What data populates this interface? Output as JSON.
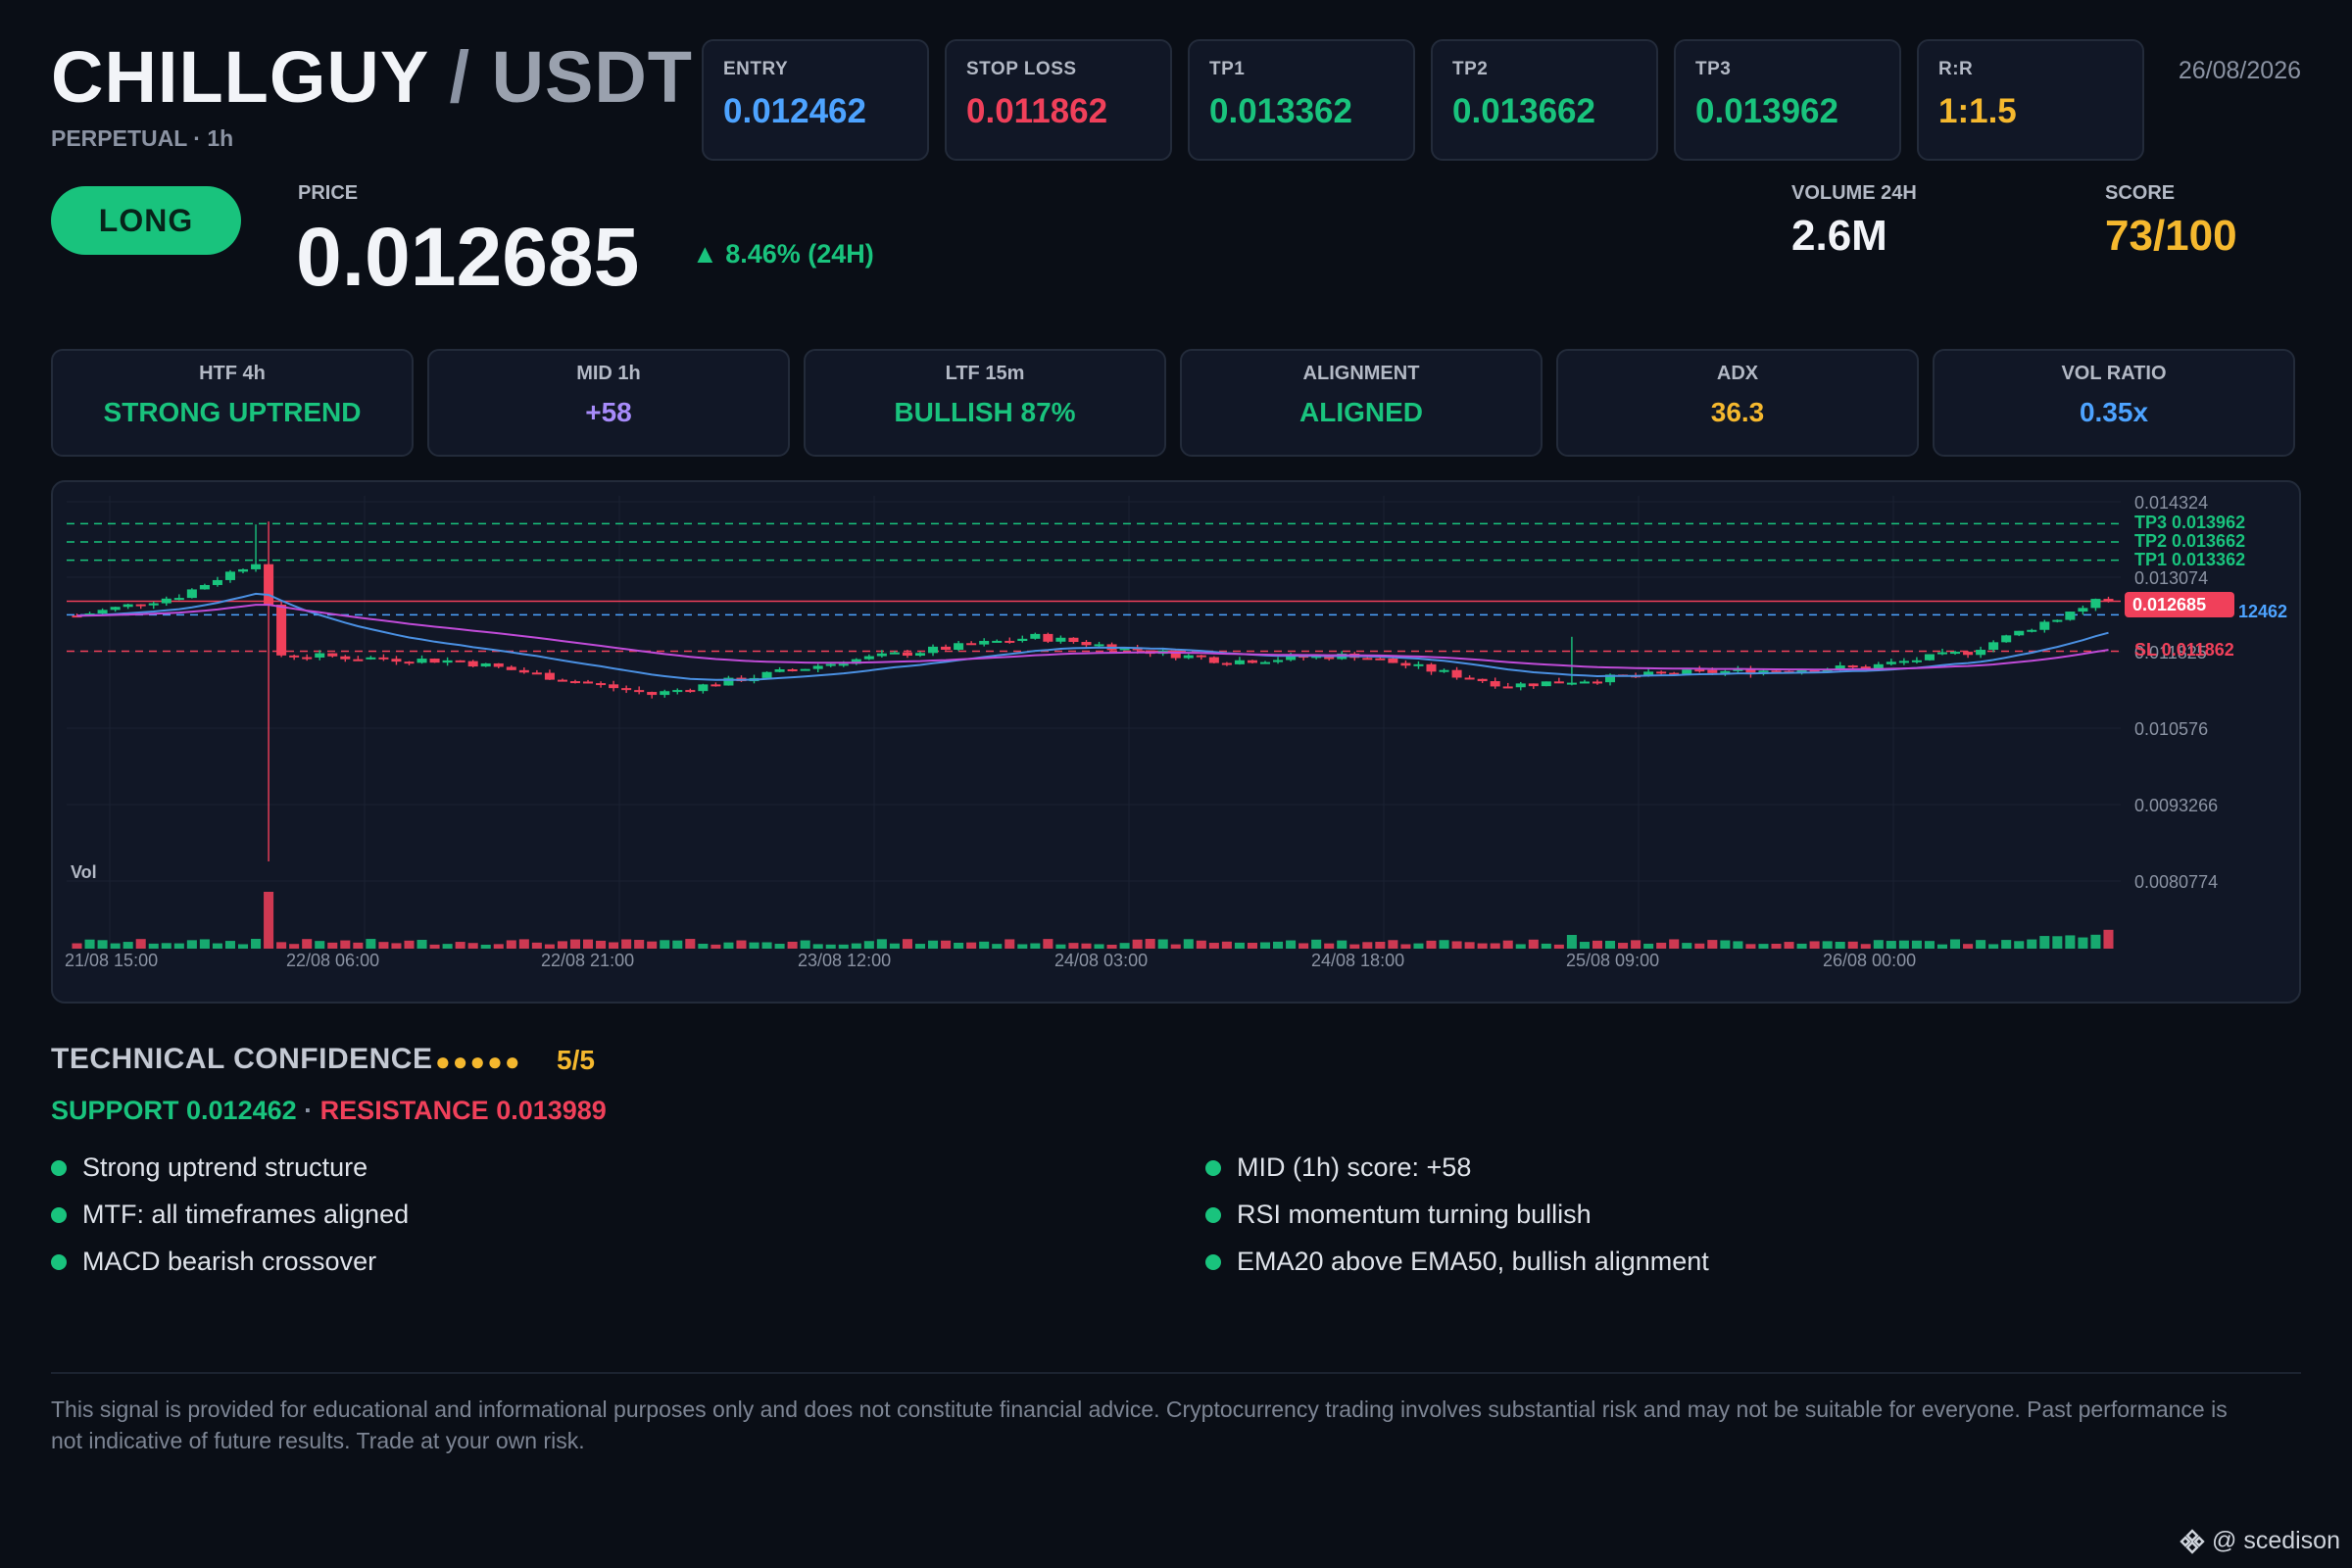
{
  "header": {
    "base": "CHILLGUY",
    "separator": "/",
    "quote": "USDT",
    "subtitle": "PERPETUAL · 1h",
    "date": "26/08/2026"
  },
  "levels": [
    {
      "label": "ENTRY",
      "value": "0.012462",
      "color": "#4da3ff"
    },
    {
      "label": "STOP LOSS",
      "value": "0.011862",
      "color": "#f0405a"
    },
    {
      "label": "TP1",
      "value": "0.013362",
      "color": "#19c37d"
    },
    {
      "label": "TP2",
      "value": "0.013662",
      "color": "#19c37d"
    },
    {
      "label": "TP3",
      "value": "0.013962",
      "color": "#19c37d"
    },
    {
      "label": "R:R",
      "value": "1:1.5",
      "color": "#f5b82e"
    }
  ],
  "signal": {
    "side": "LONG",
    "price_label": "PRICE",
    "price": "0.012685",
    "change": "▲ 8.46% (24H)",
    "volume_label": "VOLUME 24H",
    "volume": "2.6M",
    "score_label": "SCORE",
    "score": "73/100"
  },
  "indicators": [
    {
      "label": "HTF 4h",
      "value": "STRONG UPTREND",
      "color": "#19c37d"
    },
    {
      "label": "MID 1h",
      "value": "+58",
      "color": "#a78bfa"
    },
    {
      "label": "LTF 15m",
      "value": "BULLISH 87%",
      "color": "#19c37d"
    },
    {
      "label": "ALIGNMENT",
      "value": "ALIGNED",
      "color": "#19c37d"
    },
    {
      "label": "ADX",
      "value": "36.3",
      "color": "#f5b82e"
    },
    {
      "label": "VOL RATIO",
      "value": "0.35x",
      "color": "#4da3ff"
    }
  ],
  "chart": {
    "vol_label": "Vol",
    "y_ticks": [
      "0.014324",
      "0.013074",
      "0.011825",
      "0.010576",
      "0.0093266",
      "0.0080774"
    ],
    "x_ticks": [
      "21/08 15:00",
      "22/08 06:00",
      "22/08 21:00",
      "23/08 12:00",
      "24/08 03:00",
      "24/08 18:00",
      "25/08 09:00",
      "26/08 00:00"
    ],
    "level_labels": {
      "tp3": "TP3 0.013962",
      "tp2": "TP2 0.013662",
      "tp1": "TP1 0.013362",
      "price": "0.012685",
      "entry": "12462",
      "sl": "SL 0.011862"
    }
  },
  "confidence": {
    "title": "TECHNICAL CONFIDENCE",
    "dots": "●●●●●",
    "score": "5/5",
    "support": "SUPPORT 0.012462",
    "dot_sep": "·",
    "resistance": "RESISTANCE 0.013989",
    "left_points": [
      "Strong uptrend structure",
      "MTF: all timeframes aligned",
      "MACD bearish crossover"
    ],
    "right_points": [
      "MID (1h) score: +58",
      "RSI momentum turning bullish",
      "EMA20 above EMA50, bullish alignment"
    ]
  },
  "disclaimer": "This signal is provided for educational and informational purposes only and does not constitute financial advice. Cryptocurrency trading involves substantial risk and may not be suitable for everyone. Past performance is not indicative of future results. Trade at your own risk.",
  "watermark": "@ scedison"
}
